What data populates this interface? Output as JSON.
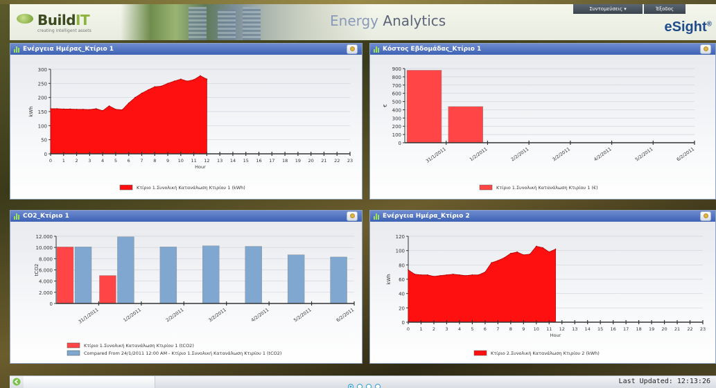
{
  "header": {
    "logo_main": "Build",
    "logo_accent": "IT",
    "logo_tagline": "creating intelligent assets",
    "app_title_first": "Energy",
    "app_title_rest": " Analytics",
    "brand": "eSight",
    "brand_mark": "®",
    "menu_shortcuts": "Συντομεύσεις ▾",
    "menu_logout": "Έξοδος"
  },
  "panels": [
    {
      "title": "Ενέργεια Ημέρας_Κτίριο 1",
      "chart_data": {
        "type": "area",
        "ylabel": "kWh",
        "xlabel": "Hour",
        "ylim": [
          0,
          300
        ],
        "yticks": [
          0,
          50,
          100,
          150,
          200,
          250,
          300
        ],
        "xticks": [
          0,
          1,
          2,
          3,
          4,
          5,
          6,
          7,
          8,
          9,
          10,
          11,
          12,
          13,
          14,
          15,
          16,
          17,
          18,
          19,
          20,
          21,
          22,
          23
        ],
        "x": [
          0,
          0.5,
          1,
          1.5,
          2,
          2.5,
          3,
          3.5,
          4,
          4.5,
          5,
          5.5,
          6,
          6.5,
          7,
          7.5,
          8,
          8.5,
          9,
          9.5,
          10,
          10.5,
          11,
          11.5,
          12
        ],
        "values": [
          160,
          160,
          159,
          159,
          158,
          158,
          157,
          160,
          153,
          170,
          158,
          156,
          180,
          200,
          215,
          227,
          238,
          240,
          250,
          258,
          265,
          258,
          263,
          277,
          265
        ],
        "series": [
          {
            "name": "Κτίριο 1.Συνολική Κατανάλωση Κτιρίου 1 (kWh)",
            "color": "#ff1010"
          }
        ],
        "grid": true,
        "legend": "bottom"
      }
    },
    {
      "title": "Κόστος Εβδομάδας_Κτίριο 1",
      "chart_data": {
        "type": "bar",
        "ylabel": "€",
        "ylim": [
          0,
          900
        ],
        "yticks": [
          0,
          100,
          200,
          300,
          400,
          500,
          600,
          700,
          800,
          900
        ],
        "categories": [
          "31/1/2011",
          "1/2/2011",
          "2/2/2011",
          "3/2/2011",
          "4/2/2011",
          "5/2/2011",
          "6/2/2011"
        ],
        "series": [
          {
            "name": "Κτίριο 1.Συνολική Κατανάλωση Κτιρίου 1 (€)",
            "color": "#ff4545",
            "values": [
              880,
              440,
              null,
              null,
              null,
              null,
              null
            ]
          }
        ],
        "grid": true,
        "legend": "bottom"
      }
    },
    {
      "title": "CO2_Κτίριο 1",
      "chart_data": {
        "type": "bar",
        "ylabel": "tCO2",
        "ylim": [
          0,
          12000
        ],
        "yticks": [
          0,
          2000,
          4000,
          6000,
          8000,
          10000,
          12000
        ],
        "ytick_labels": [
          "0",
          "2.000",
          "4.000",
          "6.000",
          "8.000",
          "10.000",
          "12.000"
        ],
        "categories": [
          "31/1/2011",
          "1/2/2011",
          "2/2/2011",
          "3/2/2011",
          "4/2/2011",
          "5/2/2011",
          "6/2/2011"
        ],
        "series": [
          {
            "name": "Κτίριο 1.Συνολική Κατανάλωση Κτιρίου 1 (tCO2)",
            "color": "#ff4545",
            "values": [
              10100,
              5000,
              null,
              null,
              null,
              null,
              null
            ]
          },
          {
            "name": "Compared From 24/1/2011 12:00 AM - Κτίριο 1.Συνολική Κατανάλωση Κτιρίου 1 (tCO2)",
            "color": "#7fa7cf",
            "values": [
              10100,
              11900,
              10100,
              10300,
              10200,
              8700,
              8300
            ]
          }
        ],
        "grid": true,
        "legend": "bottom"
      }
    },
    {
      "title": "Ενέργεια Ημέρα_Κτίριο 2",
      "chart_data": {
        "type": "area",
        "ylabel": "kWh",
        "xlabel": "Hour",
        "ylim": [
          0,
          120
        ],
        "yticks": [
          0,
          20,
          40,
          60,
          80,
          100,
          120
        ],
        "xticks": [
          0,
          1,
          2,
          3,
          4,
          5,
          6,
          7,
          8,
          9,
          10,
          11,
          12,
          13,
          14,
          15,
          16,
          17,
          18,
          19,
          20,
          21,
          22,
          23
        ],
        "x": [
          0,
          0.5,
          1,
          1.5,
          2,
          2.5,
          3,
          3.5,
          4,
          4.5,
          5,
          5.5,
          6,
          6.5,
          7,
          7.5,
          8,
          8.5,
          9,
          9.5,
          10,
          10.5,
          11,
          11.5
        ],
        "values": [
          73,
          67,
          66,
          66,
          64,
          65,
          66,
          67,
          66,
          65,
          66,
          66,
          70,
          83,
          86,
          90,
          96,
          98,
          94,
          95,
          106,
          104,
          98,
          102
        ],
        "series": [
          {
            "name": "Κτίριο 2.Συνολική Κατανάλωση Κτιρίου 2 (kWh)",
            "color": "#ff1010"
          }
        ],
        "grid": true,
        "legend": "bottom"
      }
    }
  ],
  "footer": {
    "last_updated": "Last Updated: 12:13:26"
  },
  "colors": {
    "panel_header": "#3d62b4",
    "series_red": "#ff1010",
    "series_blue": "#7fa7cf",
    "accent_green": "#8cb33a",
    "brand_blue": "#1e4b8c"
  },
  "icons": [
    "bar-chart-icon",
    "gear-icon",
    "back-arrow-icon"
  ]
}
